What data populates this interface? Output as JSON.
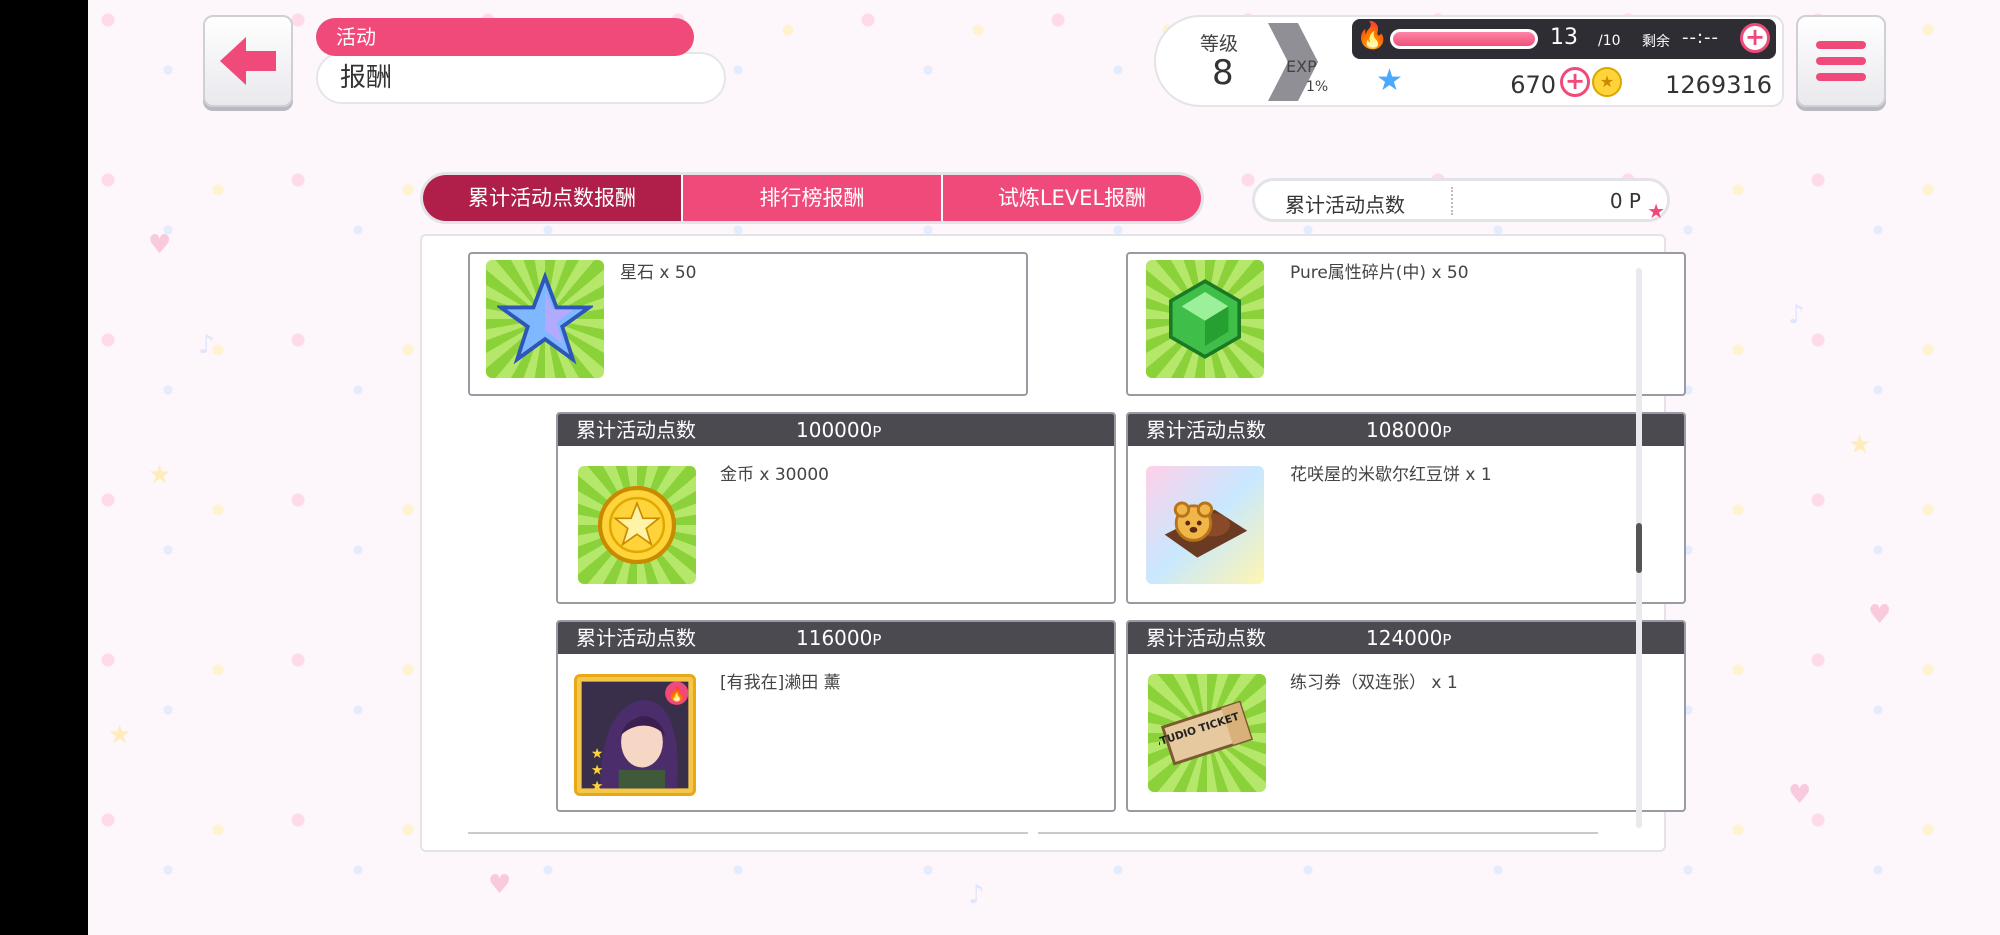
{
  "header": {
    "category": "活动",
    "title": "报酬"
  },
  "status": {
    "level_label": "等级",
    "level": "8",
    "exp_label": "EXP",
    "exp_percent": "1%",
    "exp_fraction": 0.01,
    "stamina": "13",
    "stamina_max": "/10",
    "stamina_fraction": 1.0,
    "remaining_label": "剩余",
    "remaining_value": "--:--",
    "gems": "670",
    "coins": "1269316"
  },
  "tabs": [
    {
      "label": "累计活动点数报酬",
      "active": true
    },
    {
      "label": "排行榜报酬",
      "active": false
    },
    {
      "label": "试炼LEVEL报酬",
      "active": false
    }
  ],
  "points": {
    "label": "累计活动点数",
    "value": "0 P"
  },
  "rewards": [
    {
      "req_label": "",
      "req_value": "",
      "name": "星石 x 50",
      "icon": "star-stone-icon"
    },
    {
      "req_label": "",
      "req_value": "",
      "name": "Pure属性碎片(中) x 50",
      "icon": "pure-shard-icon"
    },
    {
      "req_label": "累计活动点数",
      "req_value": "100000",
      "unit": "P",
      "name": "金币 x 30000",
      "icon": "coin-icon"
    },
    {
      "req_label": "累计活动点数",
      "req_value": "108000",
      "unit": "P",
      "name": "花咲屋的米歇尔红豆饼 x 1",
      "icon": "bean-cake-icon"
    },
    {
      "req_label": "累计活动点数",
      "req_value": "116000",
      "unit": "P",
      "name": "[有我在]濑田 薰",
      "icon": "character-card-icon"
    },
    {
      "req_label": "累计活动点数",
      "req_value": "124000",
      "unit": "P",
      "name": "练习券（双连张） x 1",
      "icon": "studio-ticket-icon"
    }
  ],
  "ticket_text": "STUDIO TICKET",
  "colors": {
    "accent": "#f04a7a",
    "accent_dark": "#b01e4a",
    "card_header": "#4a4a50"
  }
}
